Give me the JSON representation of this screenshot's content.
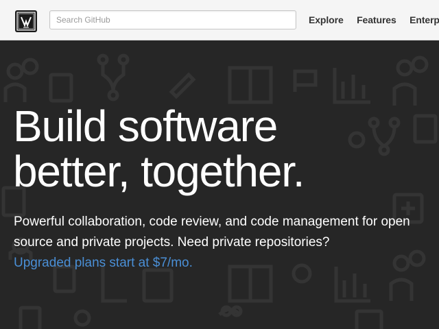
{
  "header": {
    "search_placeholder": "Search GitHub",
    "nav": [
      "Explore",
      "Features",
      "Enterprise"
    ]
  },
  "hero": {
    "headline_line1": "Build software",
    "headline_line2": "better, together.",
    "subtext": "Powerful collaboration, code review, and code management for open source and private projects. Need private repositories?",
    "plans_link": "Upgraded plans start at $7/mo."
  },
  "colors": {
    "header_bg": "#f5f5f5",
    "hero_bg": "#262626",
    "link": "#4a8fd6"
  },
  "icons": [
    "github-logo-icon",
    "background-pattern-icons"
  ]
}
